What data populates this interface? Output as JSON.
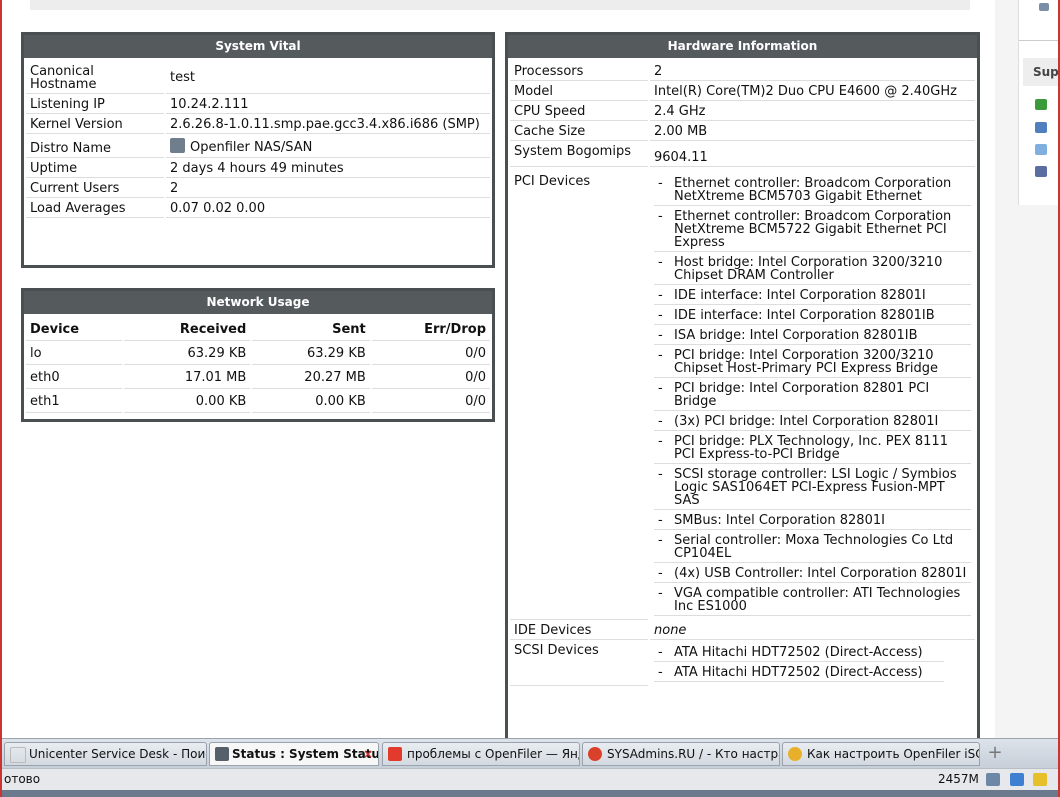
{
  "system_vital": {
    "title": "System Vital",
    "rows": [
      {
        "label": "Canonical Hostname",
        "value": "test"
      },
      {
        "label": "Listening IP",
        "value": "10.24.2.111"
      },
      {
        "label": "Kernel Version",
        "value": "2.6.26.8-1.0.11.smp.pae.gcc3.4.x86.i686 (SMP)"
      },
      {
        "label": "Distro Name",
        "value": "Openfiler NAS/SAN"
      },
      {
        "label": "Uptime",
        "value": "2 days 4 hours 49 minutes"
      },
      {
        "label": "Current Users",
        "value": "2"
      },
      {
        "label": "Load Averages",
        "value": "0.07 0.02 0.00"
      }
    ]
  },
  "network_usage": {
    "title": "Network Usage",
    "headers": [
      "Device",
      "Received",
      "Sent",
      "Err/Drop"
    ],
    "rows": [
      [
        "lo",
        "63.29 KB",
        "63.29 KB",
        "0/0"
      ],
      [
        "eth0",
        "17.01 MB",
        "20.27 MB",
        "0/0"
      ],
      [
        "eth1",
        "0.00 KB",
        "0.00 KB",
        "0/0"
      ]
    ]
  },
  "hardware": {
    "title": "Hardware Information",
    "rows": [
      {
        "label": "Processors",
        "value": "2"
      },
      {
        "label": "Model",
        "value": "Intel(R) Core(TM)2 Duo CPU E4600 @ 2.40GHz"
      },
      {
        "label": "CPU Speed",
        "value": "2.4 GHz"
      },
      {
        "label": "Cache Size",
        "value": "2.00 MB"
      },
      {
        "label": "System Bogomips",
        "value": "9604.11"
      }
    ],
    "pci_label": "PCI Devices",
    "pci_devices": [
      "Ethernet controller: Broadcom Corporation NetXtreme BCM5703 Gigabit Ethernet",
      "Ethernet controller: Broadcom Corporation NetXtreme BCM5722 Gigabit Ethernet PCI Express",
      "Host bridge: Intel Corporation 3200/3210 Chipset DRAM Controller",
      "IDE interface: Intel Corporation 82801I",
      "IDE interface: Intel Corporation 82801IB",
      "ISA bridge: Intel Corporation 82801IB",
      "PCI bridge: Intel Corporation 3200/3210 Chipset Host-Primary PCI Express Bridge",
      "PCI bridge: Intel Corporation 82801 PCI Bridge",
      "(3x) PCI bridge: Intel Corporation 82801I",
      "PCI bridge: PLX Technology, Inc. PEX 8111 PCI Express-to-PCI Bridge",
      "SCSI storage controller: LSI Logic / Symbios Logic SAS1064ET PCI-Express Fusion-MPT SAS",
      "SMBus: Intel Corporation 82801I",
      "Serial controller: Moxa Technologies Co Ltd CP104EL",
      "(4x) USB Controller: Intel Corporation 82801I",
      "VGA compatible controller: ATI Technologies Inc ES1000"
    ],
    "ide_label": "IDE Devices",
    "ide_value": "none",
    "scsi_label": "SCSI Devices",
    "scsi_devices": [
      "ATA Hitachi HDT72502 (Direct-Access)",
      "ATA Hitachi HDT72502 (Direct-Access)"
    ]
  },
  "sidebar": {
    "heading": "Sup"
  },
  "tabs": [
    {
      "label": "Unicenter Service Desk - Поиск с...",
      "active": false,
      "icon_color": "#e8e8e8"
    },
    {
      "label": "Status : System Status",
      "active": true,
      "icon_color": "#55606b"
    },
    {
      "label": "проблемы с OpenFiler — Янд...",
      "active": false,
      "icon_color": "#e23b2e"
    },
    {
      "label": "SYSAdmins.RU / - Кто настра...",
      "active": false,
      "icon_color": "#d9412a"
    },
    {
      "label": "Как настроить OpenFiler iSCSI...",
      "active": false,
      "icon_color": "#e8b02a"
    }
  ],
  "tab_close_glyph": "×",
  "new_tab_glyph": "+",
  "statusbar": {
    "status": "отово",
    "memory": "2457M"
  }
}
